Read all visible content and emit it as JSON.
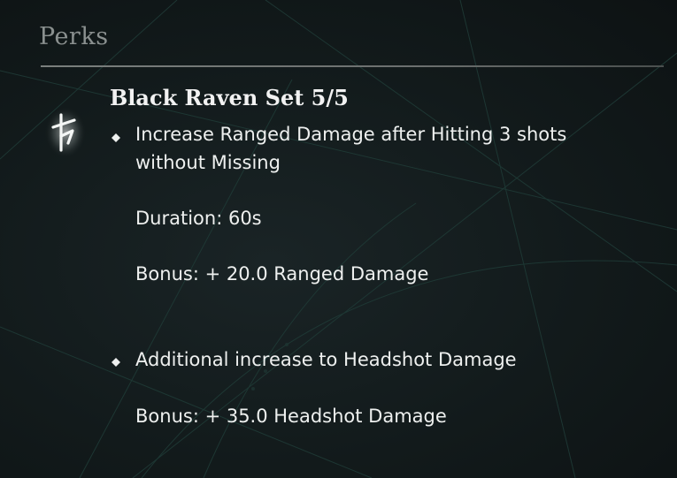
{
  "section_title": "Perks",
  "perk": {
    "icon": "raven-rune-icon",
    "set_title": "Black Raven Set 5/5",
    "entries": [
      {
        "line1": "Increase Ranged Damage after Hitting 3 shots",
        "line2": "without Missing",
        "duration": "Duration: 60s",
        "bonus": "Bonus: + 20.0 Ranged Damage"
      },
      {
        "line1": "Additional increase to Headshot Damage",
        "bonus": "Bonus: + 35.0 Headshot Damage"
      }
    ]
  },
  "colors": {
    "background": "#121a1b",
    "title": "#8a908f",
    "text": "#eef0ef"
  }
}
